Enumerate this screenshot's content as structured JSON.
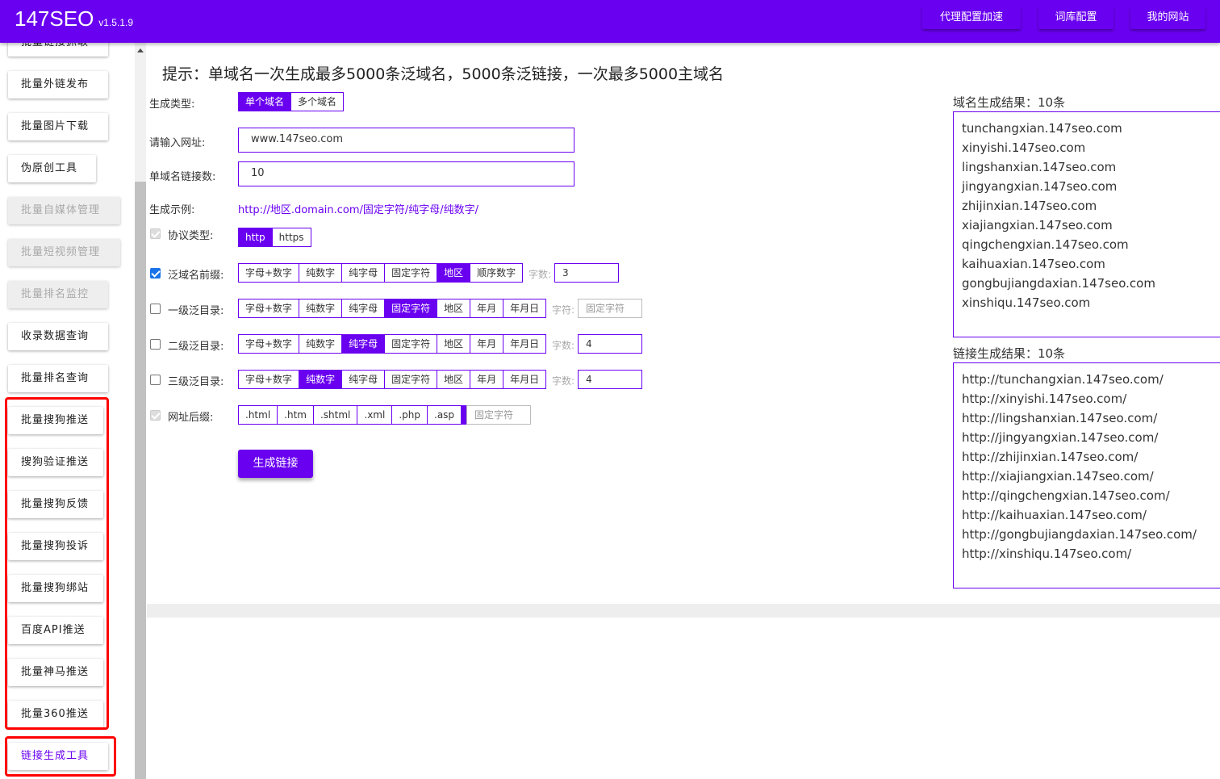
{
  "header": {
    "brand": "147SEO",
    "version": "v1.5.1.9",
    "buttons": [
      "代理配置加速",
      "词库配置",
      "我的网站"
    ]
  },
  "sidebar": {
    "items": [
      {
        "label": "批量链接抓取",
        "state": "partial"
      },
      {
        "label": "批量外链发布",
        "state": "normal"
      },
      {
        "label": "批量图片下载",
        "state": "normal"
      },
      {
        "label": "伪原创工具",
        "state": "normal"
      },
      {
        "label": "批量自媒体管理",
        "state": "disabled"
      },
      {
        "label": "批量短视频管理",
        "state": "disabled"
      },
      {
        "label": "批量排名监控",
        "state": "disabled"
      },
      {
        "label": "收录数据查询",
        "state": "normal"
      },
      {
        "label": "批量排名查询",
        "state": "normal"
      },
      {
        "label": "批量搜狗推送",
        "state": "normal"
      },
      {
        "label": "搜狗验证推送",
        "state": "normal"
      },
      {
        "label": "批量搜狗反馈",
        "state": "normal"
      },
      {
        "label": "批量搜狗投诉",
        "state": "normal"
      },
      {
        "label": "批量搜狗绑站",
        "state": "normal"
      },
      {
        "label": "百度API推送",
        "state": "normal"
      },
      {
        "label": "批量神马推送",
        "state": "normal"
      },
      {
        "label": "批量360推送",
        "state": "normal"
      },
      {
        "label": "链接生成工具",
        "state": "active"
      }
    ]
  },
  "main": {
    "hint": "提示：单域名一次生成最多5000条泛域名，5000条泛链接，一次最多5000主域名",
    "gen_type": {
      "label": "生成类型:",
      "options": [
        "单个域名",
        "多个域名"
      ],
      "selected": 0
    },
    "url_input": {
      "label": "请输入网址:",
      "value": "www.147seo.com"
    },
    "link_count": {
      "label": "单域名链接数:",
      "value": "10"
    },
    "example": {
      "label": "生成示例:",
      "value": "http://地区.domain.com/固定字符/纯字母/纯数字/"
    },
    "protocol": {
      "label": "协议类型:",
      "options": [
        "http",
        "https"
      ],
      "selected": 0,
      "checked": true
    },
    "prefix": {
      "label": "泛域名前缀:",
      "checked": true,
      "options": [
        "字母+数字",
        "纯数字",
        "纯字母",
        "固定字符",
        "地区",
        "顺序数字"
      ],
      "selected": 4,
      "extra_label": "字数:",
      "extra_value": "3"
    },
    "level1": {
      "label": "一级泛目录:",
      "checked": false,
      "options": [
        "字母+数字",
        "纯数字",
        "纯字母",
        "固定字符",
        "地区",
        "年月",
        "年月日"
      ],
      "selected": 3,
      "extra_label": "字符:",
      "extra_value": "固定字符"
    },
    "level2": {
      "label": "二级泛目录:",
      "checked": false,
      "options": [
        "字母+数字",
        "纯数字",
        "纯字母",
        "固定字符",
        "地区",
        "年月",
        "年月日"
      ],
      "selected": 2,
      "extra_label": "字数:",
      "extra_value": "4"
    },
    "level3": {
      "label": "三级泛目录:",
      "checked": false,
      "options": [
        "字母+数字",
        "纯数字",
        "纯字母",
        "固定字符",
        "地区",
        "年月",
        "年月日"
      ],
      "selected": 1,
      "extra_label": "字数:",
      "extra_value": "4"
    },
    "suffix": {
      "label": "网址后缀:",
      "checked": true,
      "options": [
        ".html",
        ".htm",
        ".shtml",
        ".xml",
        ".php",
        ".asp",
        "/"
      ],
      "selected": 6,
      "extra_value": "固定字符"
    },
    "generate_button": "生成链接"
  },
  "results": {
    "domain_title": "域名生成结果：10条",
    "domains": [
      "tunchangxian.147seo.com",
      "xinyishi.147seo.com",
      "lingshanxian.147seo.com",
      "jingyangxian.147seo.com",
      "zhijinxian.147seo.com",
      "xiajiangxian.147seo.com",
      "qingchengxian.147seo.com",
      "kaihuaxian.147seo.com",
      "gongbujiangdaxian.147seo.com",
      "xinshiqu.147seo.com"
    ],
    "link_title": "链接生成结果：10条",
    "links": [
      "http://tunchangxian.147seo.com/",
      "http://xinyishi.147seo.com/",
      "http://lingshanxian.147seo.com/",
      "http://jingyangxian.147seo.com/",
      "http://zhijinxian.147seo.com/",
      "http://xiajiangxian.147seo.com/",
      "http://qingchengxian.147seo.com/",
      "http://kaihuaxian.147seo.com/",
      "http://gongbujiangdaxian.147seo.com/",
      "http://xinshiqu.147seo.com/"
    ]
  }
}
